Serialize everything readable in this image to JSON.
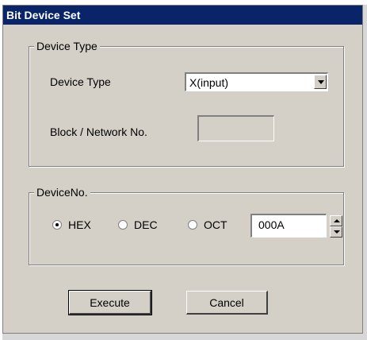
{
  "window": {
    "title": "Bit Device Set"
  },
  "device_type_group": {
    "title": "Device Type",
    "device_type_label": "Device Type",
    "device_type_value": "X(input)",
    "block_label": "Block / Network No.",
    "block_value": ""
  },
  "device_no_group": {
    "title": "DeviceNo.",
    "radios": [
      {
        "label": "HEX",
        "checked": true
      },
      {
        "label": "DEC",
        "checked": false
      },
      {
        "label": "OCT",
        "checked": false
      }
    ],
    "value": "000A"
  },
  "buttons": {
    "execute": "Execute",
    "cancel": "Cancel"
  },
  "icons": {
    "dropdown": "chevron-down-icon",
    "spin_up": "spin-up-icon",
    "spin_down": "spin-down-icon",
    "radio": "radio-icon"
  }
}
